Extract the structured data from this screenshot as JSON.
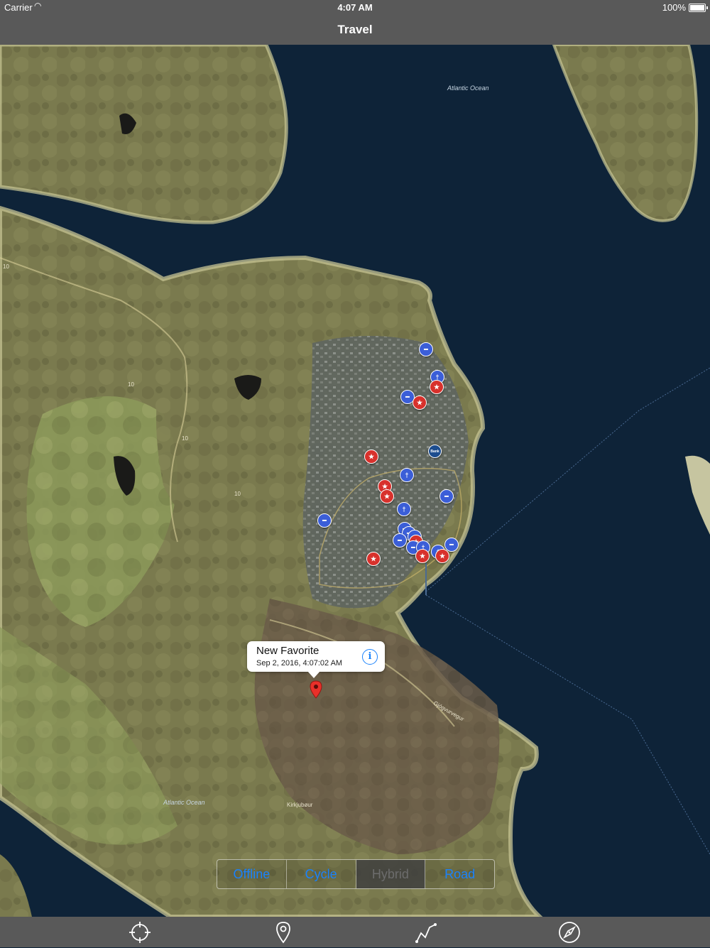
{
  "status_bar": {
    "carrier": "Carrier",
    "wifi_icon": "wifi-icon",
    "time": "4:07 AM",
    "battery_percent": "100%",
    "battery_icon": "battery-full-icon"
  },
  "nav_bar": {
    "title": "Travel"
  },
  "map": {
    "style": "satellite-hybrid",
    "ocean_labels": [
      "Atlantic Ocean",
      "Atlantic Ocean"
    ],
    "place_labels": [
      "Kirkjubøur"
    ],
    "road_labels": [
      "10",
      "10",
      "10",
      "10",
      "Gjógvurvegur"
    ],
    "poi_types": [
      "hotel",
      "restaurant",
      "attraction",
      "bank"
    ],
    "bank_label": "Bank",
    "colors": {
      "ocean": "#0e2338",
      "land": "#7d7e4f",
      "hotel_marker": "#3b5ed8",
      "attraction_marker": "#d8312c",
      "pin": "#e8302a"
    }
  },
  "callout": {
    "title": "New Favorite",
    "subtitle": "Sep 2, 2016, 4:07:02 AM",
    "info_icon": "info-icon"
  },
  "map_type_control": {
    "options": [
      "Offline",
      "Cycle",
      "Hybrid",
      "Road"
    ],
    "selected": "Hybrid"
  },
  "tab_bar": {
    "items": [
      {
        "icon": "crosshair-location-icon"
      },
      {
        "icon": "map-pin-icon"
      },
      {
        "icon": "route-icon"
      },
      {
        "icon": "compass-icon"
      }
    ]
  }
}
